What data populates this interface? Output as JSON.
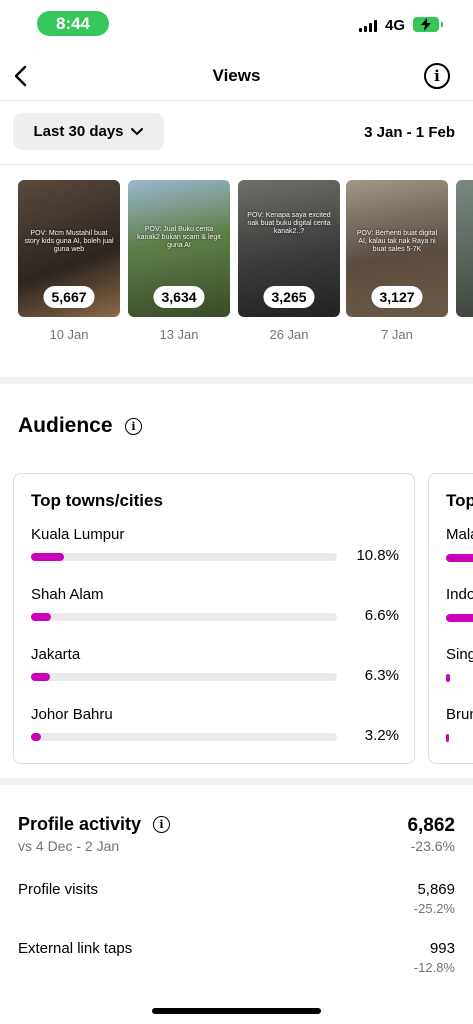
{
  "status": {
    "time": "8:44",
    "network": "4G"
  },
  "nav": {
    "title": "Views"
  },
  "filter": {
    "range_label": "Last 30 days",
    "date_range": "3 Jan - 1 Feb"
  },
  "reels": [
    {
      "caption": "POV: Mcm Mustahil buat story kids guna AI, boleh jual guna web",
      "views": "5,667",
      "date": "10 Jan"
    },
    {
      "caption": "POV: Jual Buku cerita kanak2 bukan scam & legit guna AI",
      "views": "3,634",
      "date": "13 Jan"
    },
    {
      "caption": "POV: Kenapa saya excited nak buat buku digital cerita kanak2..?",
      "views": "3,265",
      "date": "26 Jan"
    },
    {
      "caption": "POV: Berhenti buat digital AI, kalau tak nak Raya ni buat sales 5-7K",
      "views": "3,127",
      "date": "7 Jan"
    }
  ],
  "audience": {
    "title": "Audience",
    "towns_card": {
      "title": "Top towns/cities",
      "rows": [
        {
          "name": "Kuala Lumpur",
          "pct": "10.8%",
          "value": 10.8
        },
        {
          "name": "Shah Alam",
          "pct": "6.6%",
          "value": 6.6
        },
        {
          "name": "Jakarta",
          "pct": "6.3%",
          "value": 6.3
        },
        {
          "name": "Johor Bahru",
          "pct": "3.2%",
          "value": 3.2
        }
      ]
    },
    "countries_card": {
      "title": "Top",
      "rows": [
        "Mala",
        "Indo",
        "Sing",
        "Brun"
      ]
    }
  },
  "profile_activity": {
    "title": "Profile activity",
    "compare": "vs 4 Dec - 2 Jan",
    "total": "6,862",
    "total_change": "-23.6%",
    "metrics": [
      {
        "label": "Profile visits",
        "value": "5,869",
        "change": "-25.2%"
      },
      {
        "label": "External link taps",
        "value": "993",
        "change": "-12.8%"
      }
    ]
  },
  "colors": {
    "accent": "#cc00bb",
    "time_pill": "#35c759"
  }
}
